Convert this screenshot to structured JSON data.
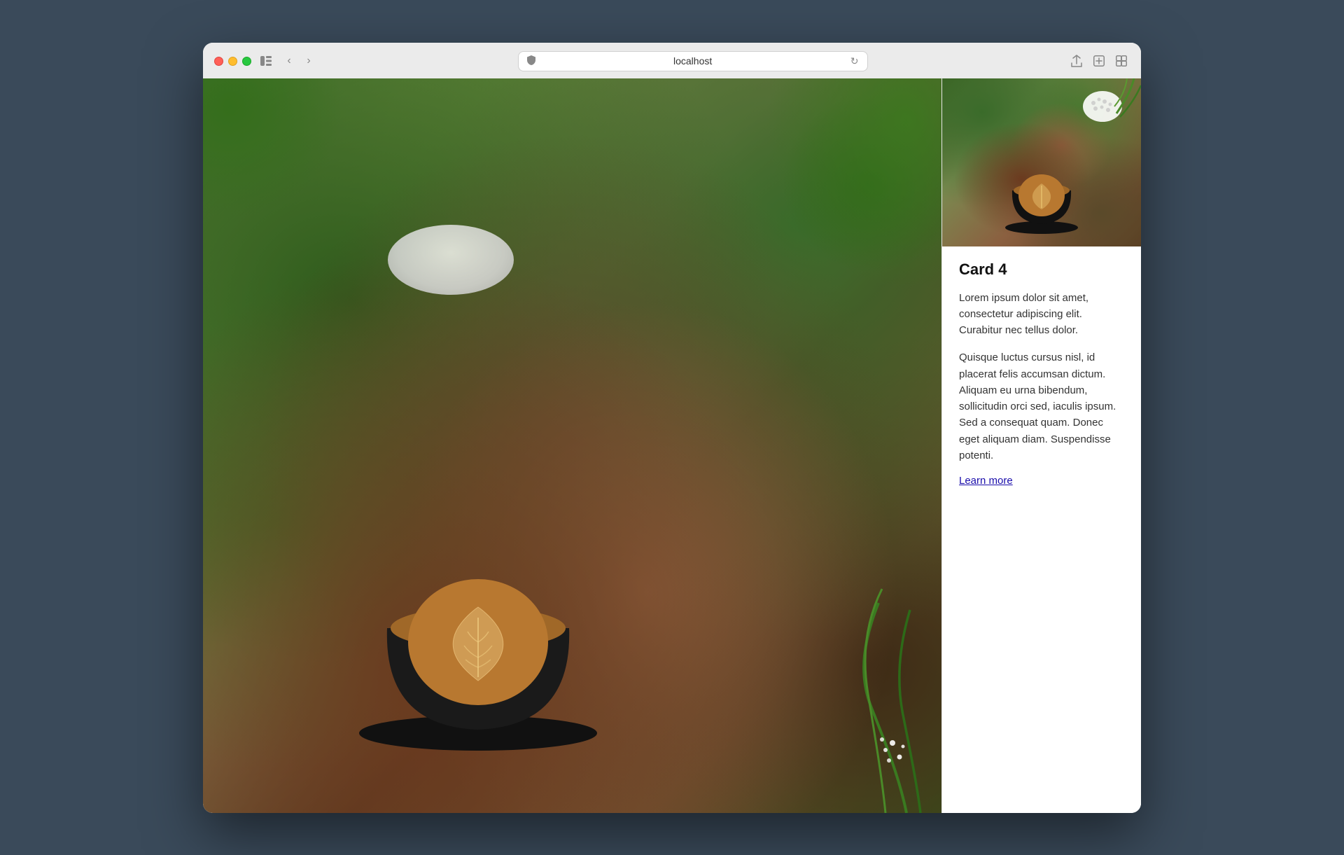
{
  "browser": {
    "url": "localhost",
    "traffic_lights": {
      "close": "close",
      "minimize": "minimize",
      "maximize": "maximize"
    }
  },
  "card": {
    "title": "Card 4",
    "paragraph1": "Lorem ipsum dolor sit amet, consectetur adipiscing elit. Curabitur nec tellus dolor.",
    "paragraph2": "Quisque luctus cursus nisl, id placerat felis accumsan dictum. Aliquam eu urna bibendum, sollicitudin orci sed, iaculis ipsum. Sed a consequat quam. Donec eget aliquam diam. Suspendisse potenti.",
    "link_label": "Learn more"
  }
}
